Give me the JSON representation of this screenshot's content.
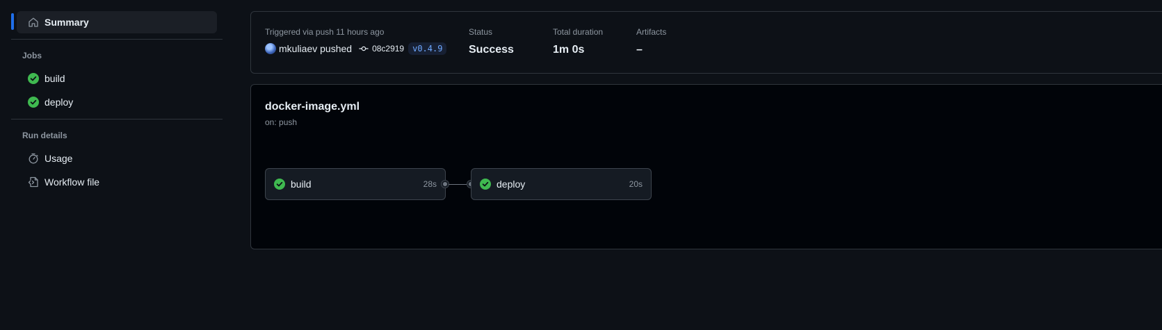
{
  "sidebar": {
    "summary_label": "Summary",
    "jobs_title": "Jobs",
    "jobs": [
      {
        "label": "build",
        "status": "success"
      },
      {
        "label": "deploy",
        "status": "success"
      }
    ],
    "run_details_title": "Run details",
    "run_details": [
      {
        "label": "Usage",
        "icon": "stopwatch-icon"
      },
      {
        "label": "Workflow file",
        "icon": "file-code-icon"
      }
    ]
  },
  "summary": {
    "trigger_text": "Triggered via push 11 hours ago",
    "actor": "mkuliaev pushed",
    "commit_sha": "08c2919",
    "tag": "v0.4.9",
    "status_label": "Status",
    "status_value": "Success",
    "duration_label": "Total duration",
    "duration_value": "1m 0s",
    "artifacts_label": "Artifacts",
    "artifacts_value": "–"
  },
  "workflow": {
    "file": "docker-image.yml",
    "trigger": "on: push",
    "jobs": [
      {
        "name": "build",
        "duration": "28s",
        "status": "success"
      },
      {
        "name": "deploy",
        "duration": "20s",
        "status": "success"
      }
    ]
  },
  "colors": {
    "background": "#0d1117",
    "success": "#3fb950",
    "accent": "#1f6feb",
    "border": "#30363d"
  }
}
